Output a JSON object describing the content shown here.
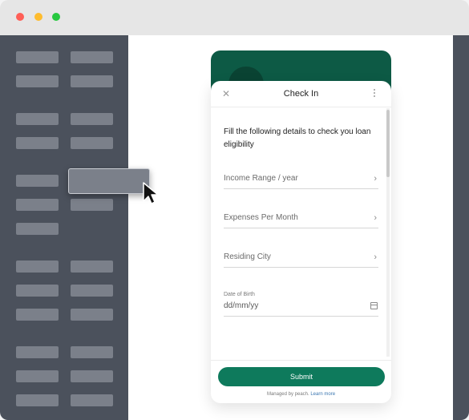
{
  "card": {
    "title": "Check In",
    "intro": "Fill the following details to check you loan eligibility",
    "fields": [
      {
        "label": "Income Range / year"
      },
      {
        "label": "Expenses Per Month"
      },
      {
        "label": "Residing City"
      }
    ],
    "dob": {
      "label": "Date of Birth",
      "placeholder": "dd/mm/yy"
    },
    "submit_label": "Submit",
    "footer": {
      "managed_by": "Managed by peach.",
      "learn_more": "Learn more"
    }
  },
  "icons": {
    "close": "close-icon",
    "more": "more-vertical-icon",
    "chevron": "chevron-right-icon",
    "calendar": "calendar-icon",
    "cursor": "cursor-arrow-icon"
  },
  "colors": {
    "brand_dark": "#0d5a45",
    "button": "#0e7a5c",
    "sidebar": "#4b515c",
    "placeholder_block": "#7b808a"
  }
}
